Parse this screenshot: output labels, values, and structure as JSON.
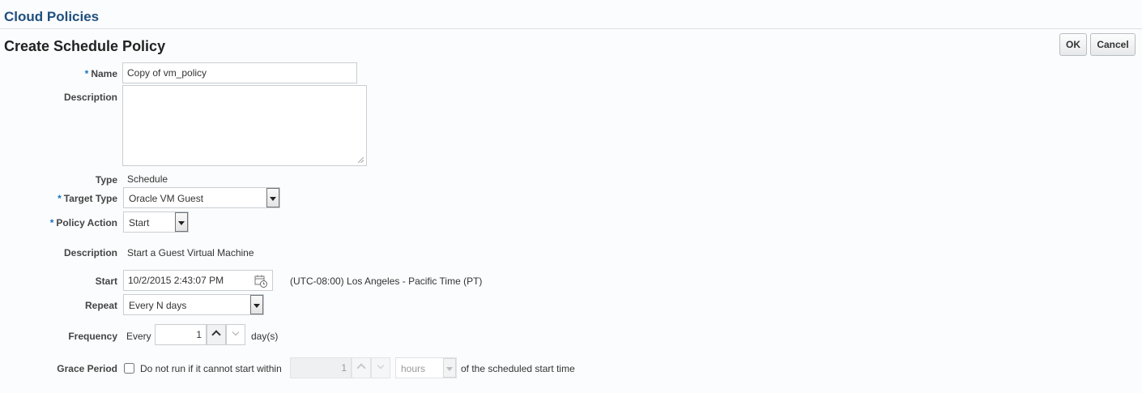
{
  "header": {
    "app_title": "Cloud Policies",
    "page_title": "Create Schedule Policy",
    "ok_label": "OK",
    "cancel_label": "Cancel"
  },
  "form": {
    "required_mark": "*",
    "name": {
      "label": "Name",
      "value": "Copy of vm_policy"
    },
    "description_input": {
      "label": "Description",
      "value": ""
    },
    "type": {
      "label": "Type",
      "value": "Schedule"
    },
    "target_type": {
      "label": "Target Type",
      "value": "Oracle VM Guest"
    },
    "policy_action": {
      "label": "Policy Action",
      "value": "Start"
    },
    "action_description": {
      "label": "Description",
      "value": "Start a Guest Virtual Machine"
    },
    "start": {
      "label": "Start",
      "value": "10/2/2015 2:43:07 PM",
      "timezone": "(UTC-08:00) Los Angeles - Pacific Time (PT)",
      "icon": "calendar-clock-icon"
    },
    "repeat": {
      "label": "Repeat",
      "value": "Every N days"
    },
    "frequency": {
      "label": "Frequency",
      "prefix": "Every",
      "value": "1",
      "unit": "day(s)"
    },
    "grace_period": {
      "label": "Grace Period",
      "checked": false,
      "text": "Do not run if it cannot start within",
      "value": "1",
      "unit": "hours",
      "suffix": "of the scheduled start time"
    }
  },
  "colors": {
    "app_title": "#1f4f7e",
    "required_mark": "#1a72c1",
    "background": "#fbfcfd"
  }
}
